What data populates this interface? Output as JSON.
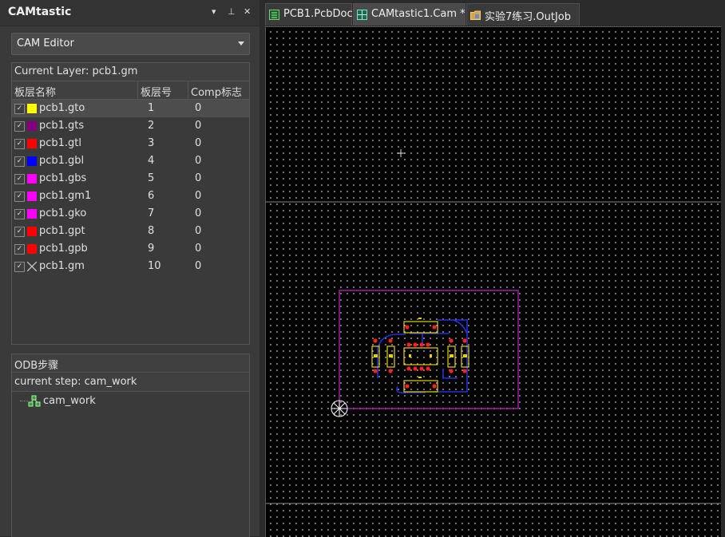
{
  "panel": {
    "title": "CAMtastic",
    "controls": [
      "▾",
      "⊥",
      "✕"
    ]
  },
  "dropdown": {
    "value": "CAM Editor"
  },
  "layers": {
    "header": "Current Layer: pcb1.gm",
    "columns": [
      "板层名称",
      "板层号",
      "Comp标志"
    ],
    "rows": [
      {
        "name": "pcb1.gto",
        "num": "1",
        "comp": "0",
        "color": "#ffff00"
      },
      {
        "name": "pcb1.gts",
        "num": "2",
        "comp": "0",
        "color": "#800080"
      },
      {
        "name": "pcb1.gtl",
        "num": "3",
        "comp": "0",
        "color": "#ff0000"
      },
      {
        "name": "pcb1.gbl",
        "num": "4",
        "comp": "0",
        "color": "#0000ff"
      },
      {
        "name": "pcb1.gbs",
        "num": "5",
        "comp": "0",
        "color": "#ff00ff"
      },
      {
        "name": "pcb1.gm1",
        "num": "6",
        "comp": "0",
        "color": "#ff00ff"
      },
      {
        "name": "pcb1.gko",
        "num": "7",
        "comp": "0",
        "color": "#ff00ff"
      },
      {
        "name": "pcb1.gpt",
        "num": "8",
        "comp": "0",
        "color": "#ff0000"
      },
      {
        "name": "pcb1.gpb",
        "num": "9",
        "comp": "0",
        "color": "#ff0000"
      },
      {
        "name": "pcb1.gm",
        "num": "10",
        "comp": "0",
        "color": "none"
      }
    ]
  },
  "odb": {
    "header": "ODB步骤",
    "current_step": "current step: cam_work",
    "item": "cam_work"
  },
  "tabs": [
    {
      "label": "PCB1.PcbDoc",
      "icon": "pcb-doc-icon"
    },
    {
      "label": "CAMtastic1.Cam *",
      "icon": "cam-doc-icon"
    },
    {
      "label": "实验7练习.OutJob",
      "icon": "outjob-icon"
    }
  ]
}
